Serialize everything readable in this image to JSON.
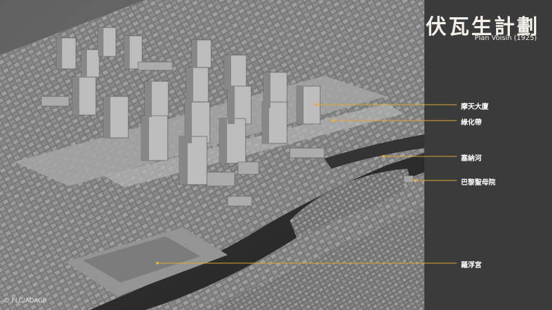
{
  "slide": {
    "title": "伏瓦生計劃",
    "subtitle": "Plan Voisin (1925)",
    "credit": "© FLC/ADAGP"
  },
  "annotations": [
    {
      "label": "摩天大廈"
    },
    {
      "label": "綠化帶"
    },
    {
      "label": "塞納河"
    },
    {
      "label": "巴黎聖母院"
    },
    {
      "label": "羅浮宮"
    }
  ],
  "colors": {
    "annotation_line": "#d9a733",
    "annotation_dot": "#e4b23d",
    "sidebar_bg": "#3b3b3b",
    "title_text": "#f4f1ea"
  },
  "image": {
    "description_icon": "city-model-photo"
  }
}
